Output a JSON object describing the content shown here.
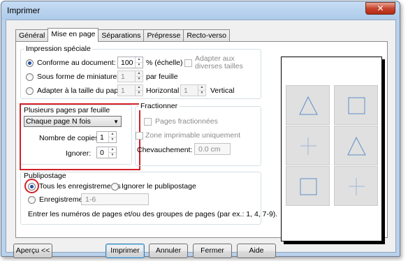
{
  "window": {
    "title": "Imprimer",
    "close_glyph": "✕"
  },
  "tabs": [
    "Général",
    "Mise en page",
    "Séparations",
    "Prépresse",
    "Recto-verso"
  ],
  "active_tab_index": 1,
  "impression_speciale": {
    "title": "Impression spéciale",
    "opt_conforme": "Conforme au document:",
    "conforme_value": "100",
    "echelle_label": "% (échelle)",
    "adapter_aux_label_1": "Adapter aux",
    "adapter_aux_label_2": "diverses tailles",
    "opt_miniatures": "Sous forme de miniatures:",
    "miniatures_value": "1",
    "par_feuille_label": "par feuille",
    "opt_adapter": "Adapter à la taille du papier:",
    "horizontal_value": "1",
    "horizontal_label": "Horizontal",
    "vertical_value": "1",
    "vertical_label": "Vertical"
  },
  "plusieurs_pages": {
    "title": "Plusieurs pages par feuille",
    "selected": "Chaque page N fois",
    "copies_label": "Nombre de copies:",
    "copies_value": "1",
    "ignorer_label": "Ignorer:",
    "ignorer_value": "0"
  },
  "fractionner": {
    "title": "Fractionner",
    "pages_fractionnees": "Pages fractionnées",
    "zone_imprimable": "Zone imprimable uniquement",
    "chevauchement_label": "Chevauchement:",
    "chevauchement_value": "0.0 cm"
  },
  "publipostage": {
    "title": "Publipostage",
    "opt_tous": "Tous les enregistrements",
    "opt_ignorer": "Ignorer le publipostage",
    "opt_enregistrements": "Enregistrements:",
    "enregistrements_value": "1-6",
    "hint": "Entrer les numéros de pages et/ou des groupes de pages (par ex.: 1, 4, 7-9)."
  },
  "preview": {
    "cells": [
      "triangle",
      "square",
      "plus",
      "triangle",
      "square",
      "plus"
    ]
  },
  "buttons": {
    "apercu": "Aperçu <<",
    "imprimer": "Imprimer",
    "annuler": "Annuler",
    "fermer": "Fermer",
    "aide": "Aide"
  },
  "colors": {
    "highlight_red": "#d32027",
    "shape_blue": "#5b8fc7",
    "plus_blue": "#9bb8d8"
  }
}
